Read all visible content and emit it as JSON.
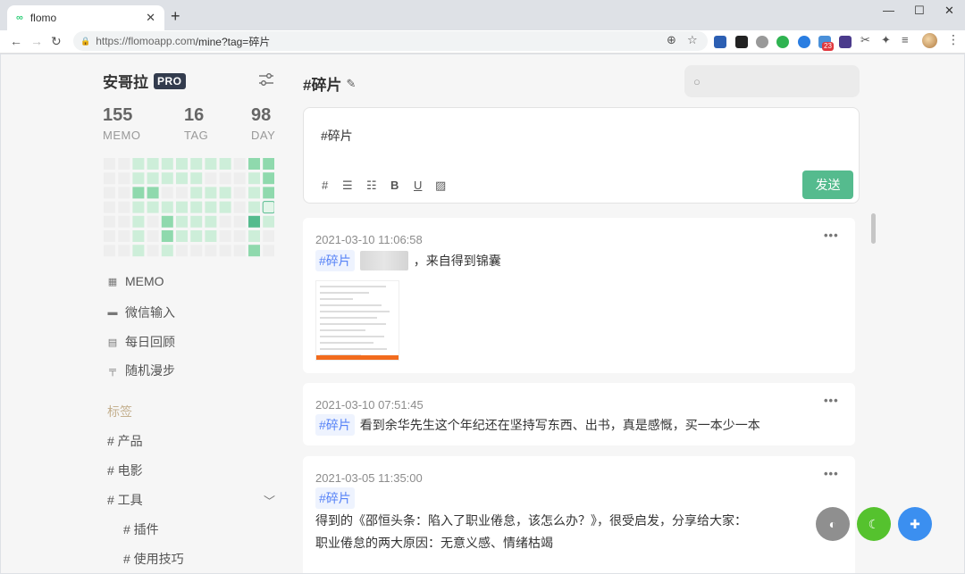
{
  "browser": {
    "tab_title": "flomo",
    "tab_favicon": "∞",
    "url_host": "https://flomoapp.com",
    "url_path": "/mine?tag=碎片",
    "extension_badge": "23"
  },
  "sidebar": {
    "username": "安哥拉",
    "badge": "PRO",
    "stats": [
      {
        "value": "155",
        "label": "MEMO"
      },
      {
        "value": "16",
        "label": "TAG"
      },
      {
        "value": "98",
        "label": "DAY"
      }
    ],
    "nav": [
      {
        "label": "MEMO",
        "icon": "grid-icon"
      },
      {
        "label": "微信输入",
        "icon": "chat-icon"
      },
      {
        "label": "每日回顾",
        "icon": "calendar-icon"
      },
      {
        "label": "随机漫步",
        "icon": "signpost-icon"
      }
    ],
    "tags_header": "标签",
    "tags": [
      {
        "label": "# 产品"
      },
      {
        "label": "# 电影"
      },
      {
        "label": "# 工具"
      },
      {
        "label": "# 插件"
      },
      {
        "label": "# 使用技巧"
      }
    ]
  },
  "heatmap": {
    "rows": 7,
    "cols": 12,
    "levels": [
      [
        0,
        0,
        1,
        1,
        1,
        1,
        1,
        1,
        1,
        0,
        2,
        2
      ],
      [
        0,
        0,
        1,
        1,
        1,
        1,
        1,
        0,
        0,
        0,
        1,
        2
      ],
      [
        0,
        0,
        2,
        2,
        0,
        0,
        1,
        1,
        1,
        0,
        1,
        2
      ],
      [
        0,
        0,
        1,
        1,
        1,
        1,
        1,
        1,
        1,
        0,
        1,
        4
      ],
      [
        0,
        0,
        1,
        0,
        2,
        1,
        1,
        1,
        0,
        0,
        3,
        1
      ],
      [
        0,
        0,
        1,
        0,
        2,
        1,
        1,
        1,
        0,
        0,
        1,
        0
      ],
      [
        0,
        0,
        1,
        0,
        1,
        0,
        0,
        0,
        0,
        0,
        2,
        0
      ]
    ],
    "colors": [
      "#eeeeee",
      "#cdeed9",
      "#8fd9ad",
      "#55bb8e",
      "#e3f5e9"
    ]
  },
  "main": {
    "title": "#碎片",
    "search_placeholder": "",
    "editor": {
      "content": "#碎片",
      "send_label": "发送",
      "tools": [
        "#",
        "list-bullet-icon",
        "list-ordered-icon",
        "B",
        "U",
        "image-icon"
      ]
    },
    "memos": [
      {
        "time": "2021-03-10 11:06:58",
        "tag": "#碎片",
        "text": "，来自得到锦囊",
        "has_image": true
      },
      {
        "time": "2021-03-10 07:51:45",
        "tag": "#碎片",
        "text": "看到余华先生这个年纪还在坚持写东西、出书，真是感慨，买一本少一本"
      },
      {
        "time": "2021-03-05 11:35:00",
        "tag": "#碎片",
        "line1": "得到的《邵恒头条：陷入了职业倦怠，该怎么办？》，很受启发，分享给大家：",
        "line2": "职业倦怠的两大原因：无意义感、情绪枯竭"
      }
    ],
    "more_label": "•••"
  },
  "fabs": [
    {
      "icon": "toggle-icon",
      "color": "#8f8f8f"
    },
    {
      "icon": "moon-icon",
      "color": "#55c22e"
    },
    {
      "icon": "plus-icon",
      "color": "#3b8ff0"
    }
  ]
}
